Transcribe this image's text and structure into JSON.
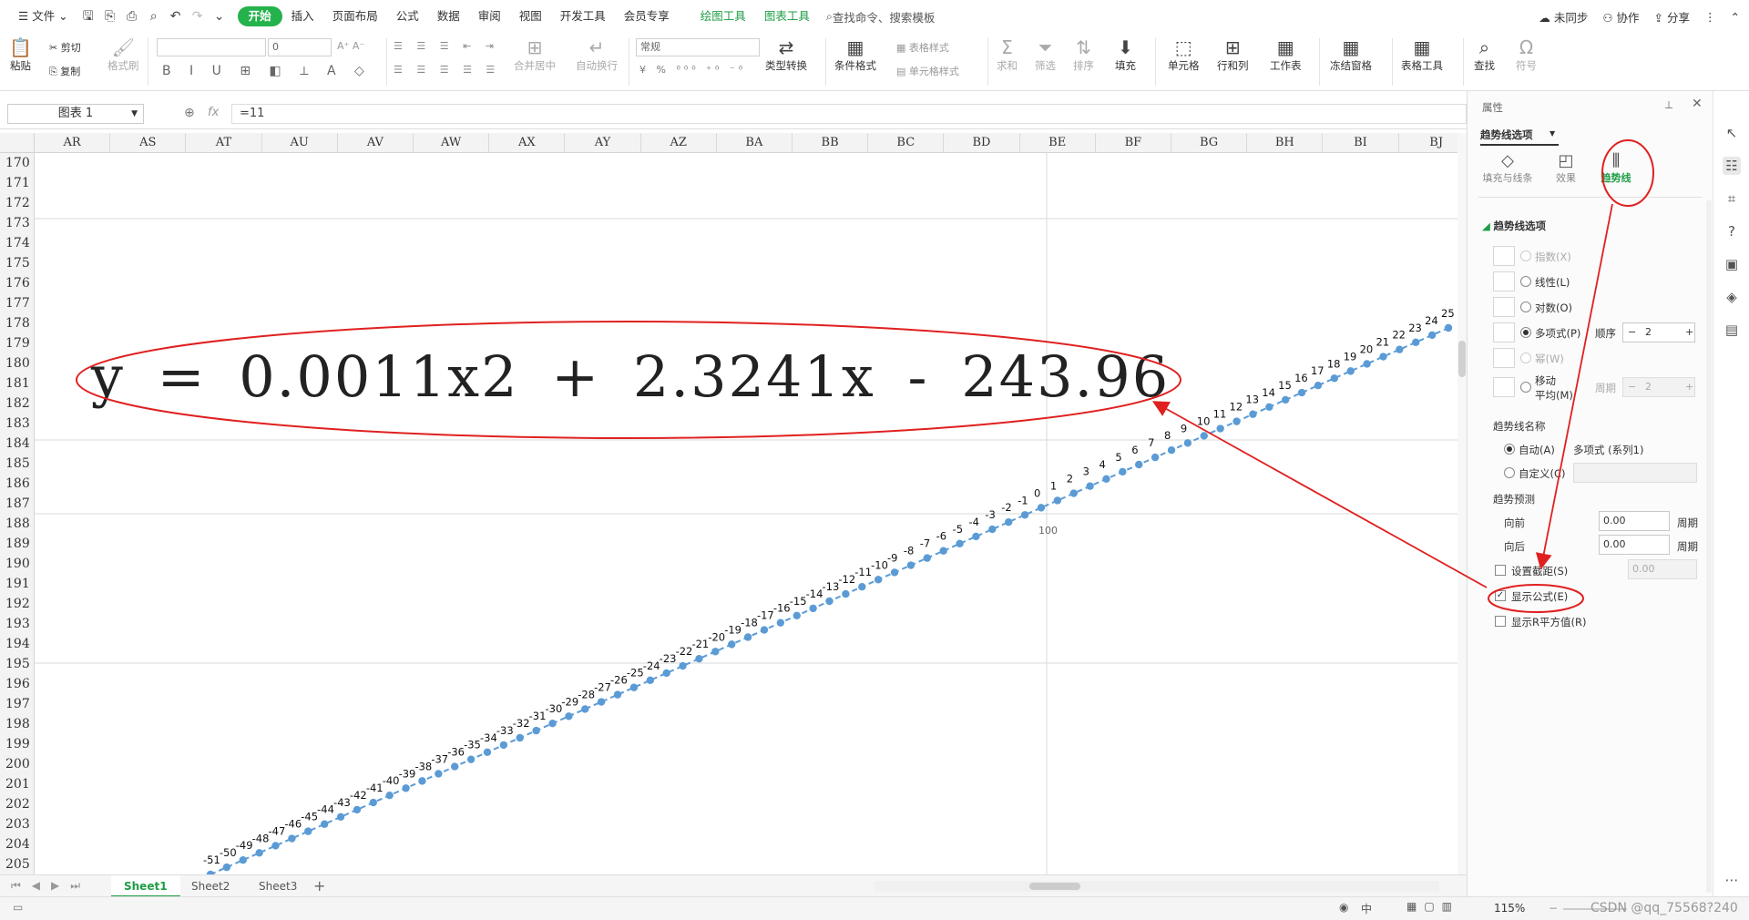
{
  "menu": {
    "file": "文件",
    "tabs": [
      "开始",
      "插入",
      "页面布局",
      "公式",
      "数据",
      "审阅",
      "视图",
      "开发工具",
      "会员专享",
      "绘图工具",
      "图表工具"
    ],
    "search": "查找命令、搜索模板",
    "sync": "未同步",
    "collab": "协作",
    "share": "分享"
  },
  "ribbon": {
    "paste": "粘贴",
    "cut": "剪切",
    "copy": "复制",
    "format_painter": "格式刷",
    "font_size": "0",
    "merge": "合并居中",
    "wrap": "自动换行",
    "number_format": "常规",
    "type_convert": "类型转换",
    "cond_format": "条件格式",
    "table_style": "表格样式",
    "cell_style": "单元格样式",
    "sum": "求和",
    "filter": "筛选",
    "sort": "排序",
    "fill": "填充",
    "cell": "单元格",
    "row_col": "行和列",
    "worksheet": "工作表",
    "freeze": "冻结窗格",
    "table_tools": "表格工具",
    "find": "查找",
    "symbol": "符号"
  },
  "formula_bar": {
    "name_box": "图表 1",
    "fx": "fx",
    "value": "=11"
  },
  "columns": [
    "AR",
    "AS",
    "AT",
    "AU",
    "AV",
    "AW",
    "AX",
    "AY",
    "AZ",
    "BA",
    "BB",
    "BC",
    "BD",
    "BE",
    "BF",
    "BG",
    "BH",
    "BI",
    "BJ"
  ],
  "rows": [
    "170",
    "171",
    "172",
    "173",
    "174",
    "175",
    "176",
    "177",
    "178",
    "179",
    "180",
    "181",
    "182",
    "183",
    "184",
    "185",
    "186",
    "187",
    "188",
    "189",
    "190",
    "191",
    "192",
    "193",
    "194",
    "195",
    "196",
    "197",
    "198",
    "199",
    "200",
    "201",
    "202",
    "203",
    "204",
    "205"
  ],
  "chart": {
    "equation": "y = 0.0011x2 + 2.3241x - 243.96",
    "axis_label_100": "100",
    "point_label_min": -51,
    "point_label_max": 25,
    "series_color": "#5b9bd5"
  },
  "sheets": [
    "Sheet1",
    "Sheet2",
    "Sheet3"
  ],
  "status": {
    "zoom": "115%",
    "watermark": "CSDN @qq_75568?240"
  },
  "panel": {
    "title": "属性",
    "dropdown": "趋势线选项",
    "tabs": [
      "填充与线条",
      "效果",
      "趋势线"
    ],
    "section": "趋势线选项",
    "types": {
      "exponential": "指数(X)",
      "linear": "线性(L)",
      "log": "对数(O)",
      "poly": "多项式(P)",
      "power": "幂(W)",
      "moving_avg_1": "移动",
      "moving_avg_2": "平均(M)"
    },
    "order_label": "顺序",
    "order_value": "2",
    "period_label": "周期",
    "period_value": "2",
    "name_section": "趋势线名称",
    "auto": "自动(A)",
    "auto_value": "多项式 (系列1)",
    "custom": "自定义(C)",
    "forecast": "趋势预测",
    "forward": "向前",
    "forward_value": "0.00",
    "backward": "向后",
    "backward_value": "0.00",
    "period_unit": "周期",
    "intercept": "设置截距(S)",
    "intercept_value": "0.00",
    "show_eq": "显示公式(E)",
    "show_r2": "显示R平方值(R)"
  }
}
